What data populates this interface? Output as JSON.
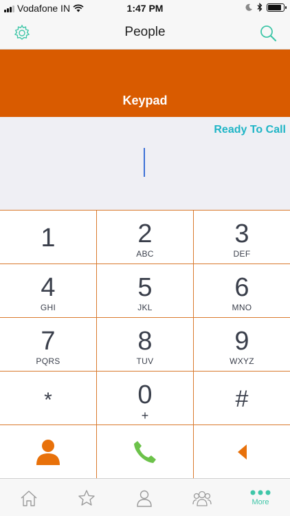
{
  "status_bar": {
    "carrier": "Vodafone IN",
    "time": "1:47 PM",
    "battery_level": 0.85
  },
  "nav": {
    "title": "People",
    "left_icon": "gear-icon",
    "right_icon": "search-icon"
  },
  "banner": {
    "label": "Keypad"
  },
  "display": {
    "status": "Ready To Call",
    "number": ""
  },
  "keys": [
    {
      "digit": "1",
      "letters": ""
    },
    {
      "digit": "2",
      "letters": "ABC"
    },
    {
      "digit": "3",
      "letters": "DEF"
    },
    {
      "digit": "4",
      "letters": "GHI"
    },
    {
      "digit": "5",
      "letters": "JKL"
    },
    {
      "digit": "6",
      "letters": "MNO"
    },
    {
      "digit": "7",
      "letters": "PQRS"
    },
    {
      "digit": "8",
      "letters": "TUV"
    },
    {
      "digit": "9",
      "letters": "WXYZ"
    },
    {
      "digit": "*",
      "letters": ""
    },
    {
      "digit": "0",
      "letters": "+"
    },
    {
      "digit": "#",
      "letters": ""
    }
  ],
  "actions": {
    "contact_icon": "person-icon",
    "call_icon": "phone-icon",
    "backspace_icon": "backspace-icon"
  },
  "tabs": [
    {
      "icon": "home-icon",
      "label": ""
    },
    {
      "icon": "star-icon",
      "label": ""
    },
    {
      "icon": "person-outline-icon",
      "label": ""
    },
    {
      "icon": "group-icon",
      "label": ""
    },
    {
      "icon": "more-dots-icon",
      "label": "More"
    }
  ],
  "colors": {
    "accent_orange": "#d95b00",
    "divider_orange": "#d9792c",
    "ready_cyan": "#1fb5c6",
    "tab_teal": "#3fc6a8",
    "call_green": "#6cc24a"
  }
}
